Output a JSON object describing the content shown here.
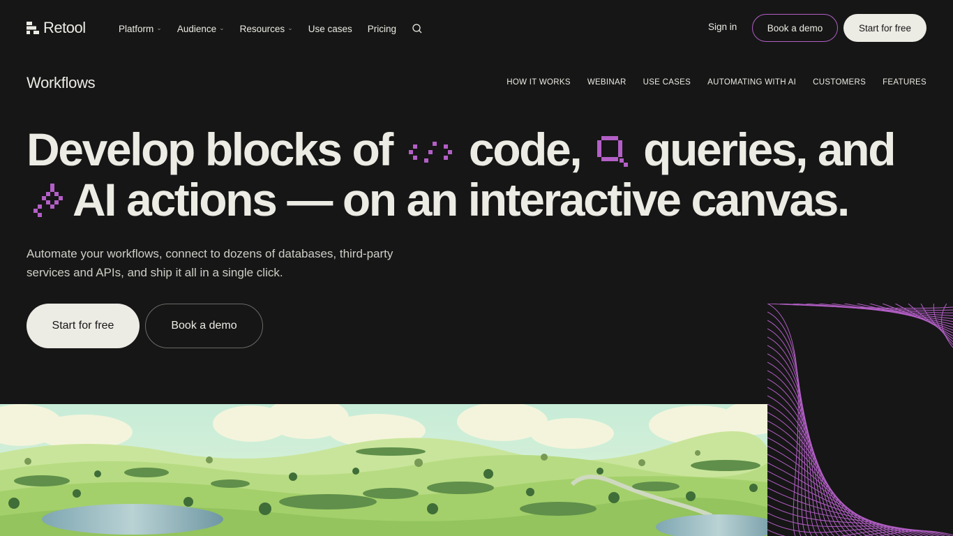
{
  "brand": {
    "name": "Retool",
    "accent": "#b35fc6",
    "cream": "#ecebe4",
    "background": "#161616"
  },
  "nav": {
    "items": [
      {
        "label": "Platform",
        "dropdown": true
      },
      {
        "label": "Audience",
        "dropdown": true
      },
      {
        "label": "Resources",
        "dropdown": true
      },
      {
        "label": "Use cases",
        "dropdown": false
      },
      {
        "label": "Pricing",
        "dropdown": false
      }
    ],
    "search_icon": "search-icon",
    "sign_in": "Sign in",
    "book_demo": "Book a demo",
    "start_free": "Start for free"
  },
  "subnav": {
    "product": "Workflows",
    "items": [
      "HOW IT WORKS",
      "WEBINAR",
      "USE CASES",
      "AUTOMATING WITH AI",
      "CUSTOMERS",
      "FEATURES"
    ]
  },
  "hero": {
    "headline": {
      "part1": "Develop blocks of",
      "part2": "code,",
      "part3": "queries, and",
      "part4": "AI actions — on an interactive canvas."
    },
    "icons": [
      "code-icon",
      "query-icon",
      "ai-sparkle-icon"
    ],
    "subtext": "Automate your workflows, connect to dozens of databases, third-party services and APIs, and ship it all in a single click.",
    "cta_primary": "Start for free",
    "cta_secondary": "Book a demo"
  }
}
